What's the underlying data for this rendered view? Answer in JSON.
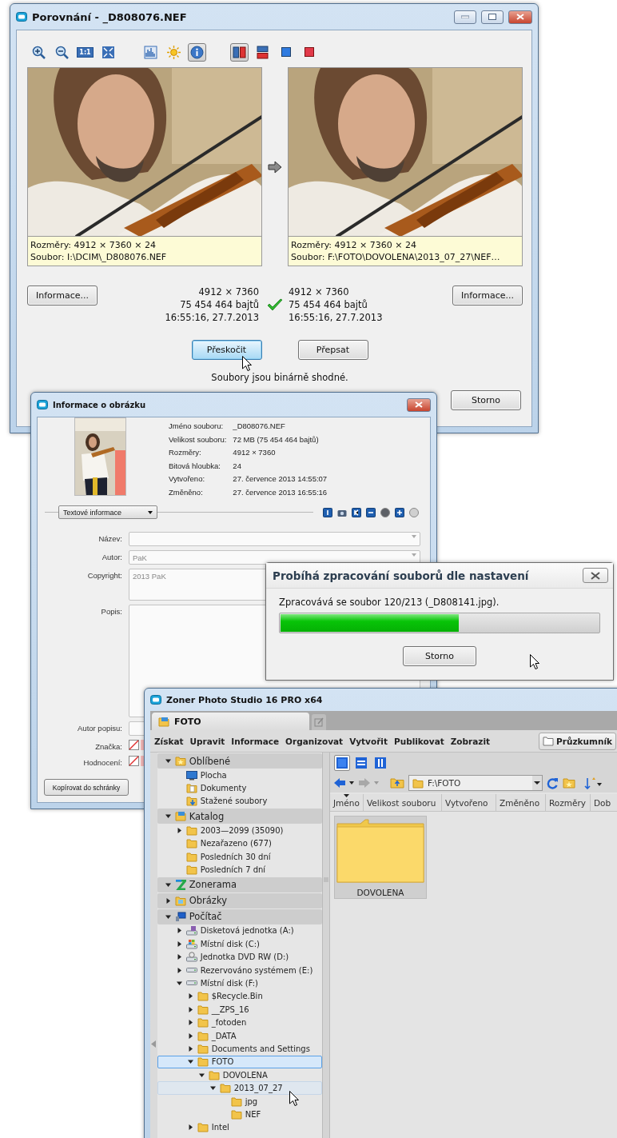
{
  "compare_window": {
    "title": "Porovnání - _D808076.NEF",
    "toolbar": [
      [
        {
          "kind": "zoom-in",
          "pressed": false
        },
        {
          "kind": "zoom-out",
          "pressed": false
        },
        {
          "kind": "actual-size",
          "label": "1:1",
          "pressed": false
        },
        {
          "kind": "fit",
          "pressed": false
        }
      ],
      [
        {
          "kind": "histogram",
          "pressed": false
        },
        {
          "kind": "sun",
          "pressed": false
        },
        {
          "kind": "info",
          "pressed": true
        }
      ],
      [
        {
          "kind": "side-by-side",
          "pressed": true
        },
        {
          "kind": "stacked",
          "pressed": false
        },
        {
          "kind": "blue-square",
          "pressed": false
        },
        {
          "kind": "red-square",
          "pressed": false
        }
      ]
    ],
    "left": {
      "dimensions": "Rozměry: 4912 × 7360 × 24",
      "file": "Soubor: I:\\DCIM\\_D808076.NEF",
      "info_button": "Informace...",
      "stats": [
        "4912 × 7360",
        "75 454 464 bajtů",
        "16:55:16, 27.7.2013"
      ]
    },
    "right": {
      "dimensions": "Rozměry: 4912 × 7360 × 24",
      "file": "Soubor: F:\\FOTO\\DOVOLENA\\2013_07_27\\NEF…",
      "info_button": "Informace...",
      "stats": [
        "4912 × 7360",
        "75 454 464 bajtů",
        "16:55:16, 27.7.2013"
      ]
    },
    "identical": true,
    "actions": [
      {
        "label": "Přeskočit",
        "focused": true
      },
      {
        "label": "Přepsat",
        "focused": false
      }
    ],
    "message": "Soubory jsou binárně shodné.",
    "cancel": "Storno"
  },
  "info_window": {
    "title": "Informace o obrázku",
    "properties": [
      {
        "label": "Jméno souboru:",
        "value": "_D808076.NEF"
      },
      {
        "label": "Velikost souboru:",
        "value": "72 MB (75 454 464 bajtů)"
      },
      {
        "label": "Rozměry:",
        "value": "4912 × 7360"
      },
      {
        "label": "Bitová hloubka:",
        "value": "24"
      },
      {
        "label": "Vytvořeno:",
        "value": "27. července 2013 14:55:07"
      },
      {
        "label": "Změněno:",
        "value": "27. července 2013 16:55:16"
      }
    ],
    "section": "Textové informace",
    "tools": [
      {
        "kind": "info"
      },
      {
        "kind": "camera"
      },
      {
        "kind": "keyword"
      },
      {
        "kind": "minus"
      },
      {
        "kind": "globe"
      },
      {
        "kind": "plus"
      },
      {
        "kind": "sphere"
      }
    ],
    "fields": [
      {
        "kind": "combo",
        "label": "Název:"
      },
      {
        "kind": "combo",
        "label": "Autor:",
        "value": "PaK"
      },
      {
        "kind": "memo",
        "label": "Copyright:",
        "value": "2013 PaK"
      },
      {
        "kind": "tall-memo",
        "label": "Popis:"
      },
      {
        "kind": "text",
        "label": "Autor popisu:"
      },
      {
        "kind": "swatch",
        "label": "Značka:"
      },
      {
        "kind": "swatch",
        "label": "Hodnocení:"
      }
    ],
    "copy_button": "Kopírovat do schránky"
  },
  "progress_window": {
    "title": "Probíhá zpracování souborů dle nastavení",
    "status": "Zpracovává se soubor 120/213 (_D808141.jpg).",
    "level": 0.56,
    "cancel": "Storno"
  },
  "zoner_window": {
    "title": "Zoner Photo Studio 16 PRO x64",
    "tab": "FOTO",
    "menu": [
      "Získat",
      "Upravit",
      "Informace",
      "Organizovat",
      "Vytvořit",
      "Publikovat",
      "Zobrazit"
    ],
    "explorer_button": "Průzkumník",
    "view_buttons": [
      {
        "kind": "single",
        "selected": true
      },
      {
        "kind": "rows",
        "selected": false
      },
      {
        "kind": "columns",
        "selected": false
      }
    ],
    "address": "F:\\FOTO",
    "columns": [
      "Jméno",
      "Velikost souboru",
      "Vytvořeno",
      "Změněno",
      "Rozměry",
      "Dob"
    ],
    "folders": [
      {
        "name": "DOVOLENA"
      }
    ],
    "tree": [
      {
        "label": "Oblíbené",
        "kind": "star-folder",
        "expanded": true,
        "selected": false,
        "hovered": false,
        "children": [
          {
            "label": "Plocha",
            "kind": "desktop",
            "selected": false,
            "hovered": false
          },
          {
            "label": "Dokumenty",
            "kind": "documents",
            "selected": false,
            "hovered": false
          },
          {
            "label": "Stažené soubory",
            "kind": "downloads",
            "selected": false,
            "hovered": false
          }
        ]
      },
      {
        "label": "Katalog",
        "kind": "catalog",
        "expanded": true,
        "selected": false,
        "hovered": false,
        "children": [
          {
            "label": "2003—2099 (35090)",
            "kind": "folder",
            "expanded": false,
            "selected": false,
            "hovered": false
          },
          {
            "label": "Nezařazeno (677)",
            "kind": "folder",
            "selected": false,
            "hovered": false
          },
          {
            "label": "Posledních 30 dní",
            "kind": "folder",
            "selected": false,
            "hovered": false
          },
          {
            "label": "Posledních 7 dní",
            "kind": "folder",
            "selected": false,
            "hovered": false
          }
        ]
      },
      {
        "label": "Zonerama",
        "kind": "zonerama",
        "expanded": true,
        "selected": false,
        "hovered": false
      },
      {
        "label": "Obrázky",
        "kind": "pictures",
        "expanded": false,
        "selected": false,
        "hovered": false
      },
      {
        "label": "Počítač",
        "kind": "computer",
        "expanded": true,
        "selected": false,
        "hovered": false,
        "children": [
          {
            "label": "Disketová jednotka (A:)",
            "kind": "floppy",
            "expanded": false,
            "selected": false,
            "hovered": false
          },
          {
            "label": "Místní disk (C:)",
            "kind": "windows-drive",
            "expanded": false,
            "selected": false,
            "hovered": false
          },
          {
            "label": "Jednotka DVD RW (D:)",
            "kind": "dvd",
            "expanded": false,
            "selected": false,
            "hovered": false
          },
          {
            "label": "Rezervováno systémem (E:)",
            "kind": "drive",
            "expanded": false,
            "selected": false,
            "hovered": false
          },
          {
            "label": "Místní disk (F:)",
            "kind": "drive",
            "expanded": true,
            "selected": false,
            "hovered": false,
            "children": [
              {
                "label": "$Recycle.Bin",
                "kind": "folder",
                "expanded": false,
                "selected": false,
                "hovered": false
              },
              {
                "label": "__ZPS_16",
                "kind": "folder",
                "expanded": false,
                "selected": false,
                "hovered": false
              },
              {
                "label": "_fotoden",
                "kind": "folder",
                "expanded": false,
                "selected": false,
                "hovered": false
              },
              {
                "label": "_DATA",
                "kind": "folder",
                "expanded": false,
                "selected": false,
                "hovered": false
              },
              {
                "label": "Documents and Settings",
                "kind": "folder",
                "expanded": false,
                "selected": false,
                "hovered": false
              },
              {
                "label": "FOTO",
                "kind": "folder",
                "expanded": true,
                "selected": true,
                "hovered": false,
                "children": [
                  {
                    "label": "DOVOLENA",
                    "kind": "folder",
                    "expanded": true,
                    "selected": false,
                    "hovered": false,
                    "children": [
                      {
                        "label": "2013_07_27",
                        "kind": "folder",
                        "expanded": true,
                        "selected": false,
                        "hovered": true,
                        "children": [
                          {
                            "label": "jpg",
                            "kind": "folder",
                            "selected": false,
                            "hovered": false
                          },
                          {
                            "label": "NEF",
                            "kind": "folder",
                            "selected": false,
                            "hovered": false
                          }
                        ]
                      }
                    ]
                  }
                ]
              },
              {
                "label": "Intel",
                "kind": "folder",
                "expanded": false,
                "selected": false,
                "hovered": false
              }
            ]
          }
        ]
      }
    ]
  }
}
